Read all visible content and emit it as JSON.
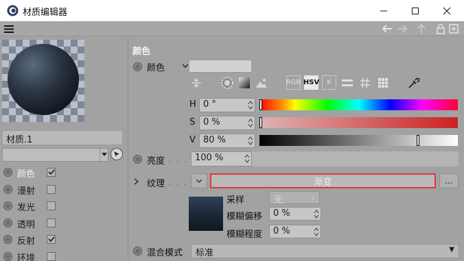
{
  "window": {
    "title": "材质编辑器",
    "minimize_glyph": "—",
    "maximize_glyph": "☐",
    "close_glyph": "✕"
  },
  "left": {
    "material_name": "材质.1",
    "channels": [
      {
        "label": "颜色",
        "checked": true,
        "active": true
      },
      {
        "label": "漫射",
        "checked": false,
        "active": false
      },
      {
        "label": "发光",
        "checked": false,
        "active": false
      },
      {
        "label": "透明",
        "checked": false,
        "active": false
      },
      {
        "label": "反射",
        "checked": true,
        "active": false
      },
      {
        "label": "环境",
        "checked": false,
        "active": false
      }
    ]
  },
  "color": {
    "section_title": "颜色",
    "color_label": "颜色",
    "mode_labels": {
      "rgb": "RGB",
      "hsv": "HSV",
      "k": "K"
    },
    "h_label": "H",
    "h_value": "0 °",
    "s_label": "S",
    "s_value": "0 %",
    "v_label": "V",
    "v_value": "80 %",
    "h_fraction": 0.0,
    "s_fraction": 0.0,
    "v_fraction": 0.8,
    "brightness_label": "亮度",
    "brightness_value": "100 %",
    "texture_label": "纹理",
    "texture_button": "渐变",
    "more_button": "...",
    "sampling_label": "采样",
    "sampling_value": "无",
    "blur_offset_label": "模糊偏移",
    "blur_offset_value": "0 %",
    "blur_level_label": "模糊程度",
    "blur_level_value": "0 %",
    "blend_label": "混合模式",
    "blend_value": "标准"
  },
  "colors": {
    "highlight_border": "#e8343a",
    "section_title": "#f4f4f4"
  }
}
